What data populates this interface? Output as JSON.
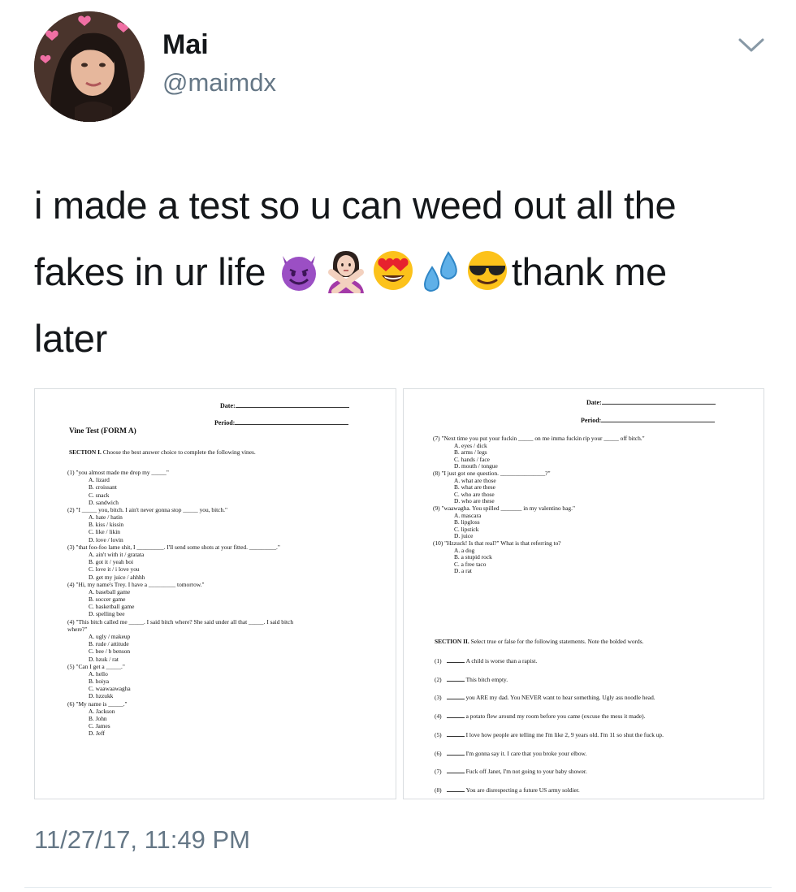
{
  "user": {
    "display_name": "Mai",
    "handle": "@maimdx"
  },
  "tweet": {
    "text_line1": "i made a test so u can weed out all the",
    "text_line2a": "fakes in ur life ",
    "text_line2b": "thank me",
    "text_line3": "later",
    "emojis": [
      "smiling-devil-emoji",
      "person-gesturing-no-emoji",
      "heart-eyes-emoji",
      "sweat-droplets-emoji",
      "sunglasses-emoji"
    ]
  },
  "timestamp": "11/27/17, 11:49 PM",
  "form_a": {
    "date_label": "Date:",
    "period_label": "Period:",
    "title": "Vine Test (FORM A)",
    "section1_label": "SECTION I.",
    "section1_instr": "Choose the best answer choice to complete the following vines.",
    "lines": [
      "(1) \"you almost made me drop my _____\"",
      "A. lizard",
      "B. croissant",
      "C. snack",
      "D. sandwich",
      "(2) \"I _____ you, bitch. I ain't never gonna stop _____ you, bitch.\"",
      "A. hate / hatin",
      "B. kiss / kissin",
      "C. like / likin",
      "D. love / lovin",
      "(3) \"that foo-foo lame shit, I _________. I'll send some shots at your fitted. _________.\"",
      "A. ain't with it / gratata",
      "B. got it / yeah boi",
      "C. love it / i love you",
      "D. get my juice / ahhhh",
      "(4) \"Hi, my name's Trey. I have a _________ tomorrow.\"",
      "A. baseball game",
      "B. soccer game",
      "C. basketball game",
      "D. spelling bee",
      "(4) \"This bitch called me _____. I said bitch where? She said under all that _____. I said bitch",
      "where?\"",
      "A. ugly / makeup",
      "B. rude / attitude",
      "C. bee / b benson",
      "D. hzuk / rat",
      "(5) \"Can I get a _____.\"",
      "A. hello",
      "B. hoiya",
      "C. waawaawagha",
      "D. hzzukk",
      "(6) \"My name is _____.\"",
      "A. Jackson",
      "B. John",
      "C. James",
      "D. Jeff"
    ]
  },
  "form_b": {
    "date_label": "Date:",
    "period_label": "Period:",
    "lines": [
      "(7) \"Next time you put your fuckin _____ on me imma fuckin rip your _____ off bitch.\"",
      "A. eyes / dick",
      "B. arms / legs",
      "C. hands / face",
      "D. mouth / tongue",
      "(8) \"I just got one question. _______________?\"",
      "A. what are those",
      "B. what are these",
      "C. who are those",
      "D. who are these",
      "(9) \"waawagha. You spilled _______ in my valentino bag.\"",
      "A. mascara",
      "B. lipgloss",
      "C. lipstick",
      "D. juice",
      "(10) \"Hzzuck! Is that real?\" What is that referring to?",
      "A. a dog",
      "B. a stupid rock",
      "C. a free taco",
      "D. a rat"
    ],
    "section2_label": "SECTION II.",
    "section2_instr": "Select true or false for the following statements. Note the bolded words.",
    "statements": [
      {
        "num": "(1)",
        "text": "A child is worse than a rapist."
      },
      {
        "num": "(2)",
        "text": "This bitch empty."
      },
      {
        "num": "(3)",
        "text": "you ARE my dad. You NEVER want to hear something. Ugly ass noodle head."
      },
      {
        "num": "(4)",
        "text": "a potato flew around my room before you came (excuse the mess it made)."
      },
      {
        "num": "(5)",
        "text": "I love how people are telling me I'm like 2, 9 years old. I'm 11 so shut the fuck up."
      },
      {
        "num": "(6)",
        "text": "I'm gonna say it. I care that you broke your elbow."
      },
      {
        "num": "(7)",
        "text": "Fuck off Janet, I'm not going to your baby shower."
      },
      {
        "num": "(8)",
        "text": "You are disrespecting a future US army soldier."
      }
    ]
  }
}
